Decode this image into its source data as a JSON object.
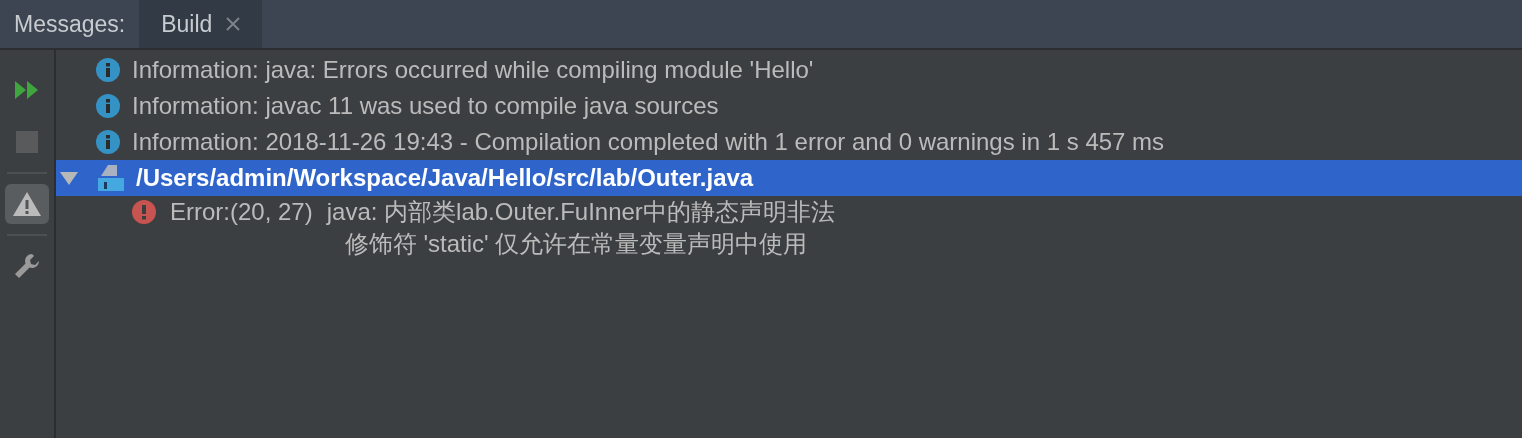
{
  "header": {
    "label": "Messages:",
    "tabs": [
      {
        "label": "Build",
        "selected": true,
        "closable": true
      }
    ]
  },
  "toolbar": [
    {
      "kind": "rerun",
      "disabled": false,
      "selected": false
    },
    {
      "kind": "stop",
      "disabled": true,
      "selected": false
    },
    {
      "kind": "warnings",
      "disabled": false,
      "selected": true
    },
    {
      "kind": "settings",
      "disabled": false,
      "selected": false
    }
  ],
  "messages": [
    {
      "kind": "info",
      "text": "Information: java: Errors occurred while compiling module 'Hello'"
    },
    {
      "kind": "info",
      "text": "Information: javac 11 was used to compile java sources"
    },
    {
      "kind": "info",
      "text": "Information: 2018-11-26 19:43 - Compilation completed with 1 error and 0 warnings in 1 s 457 ms"
    },
    {
      "kind": "file",
      "text": "/Users/admin/Workspace/Java/Hello/src/lab/Outer.java",
      "selected": true,
      "expanded": true,
      "children": [
        {
          "kind": "error",
          "location": "Error:(20, 27)",
          "lines": [
            "java: 内部类lab.Outer.FuInner中的静态声明非法",
            "修饰符 'static' 仅允许在常量变量声明中使用"
          ]
        }
      ]
    }
  ]
}
